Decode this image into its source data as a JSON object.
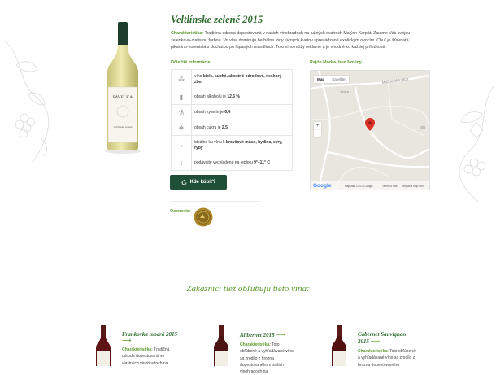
{
  "product": {
    "title": "Veltlínske zelené 2015",
    "desc_label": "Charakteristika:",
    "desc_text": "Tradičná odroda dopestovaná v našich vinohradoch na južných svahoch Malých Karpát. Zaujme Vás svojou zelenkavo-zlatistou farbou. Vo víne dominujú herbálne tóny lúčnych kvetov sprevádzané exotickým ovocím. Chuť je šťavnatá, pikantno-korenistá s dochutou po lúpaných mandliach. Toto víno môžy reklame a je vhodné ku každej príležitosti.",
    "bottle_brand": "PAVELKA",
    "bottle_name": "Veltlínske zelené"
  },
  "details": {
    "label": "Dôležité informácie:",
    "rows": [
      {
        "icon": "grape-icon",
        "pre": "víno ",
        "bold": "biele, suché, akostné odrodové, neskorý zber",
        "post": ""
      },
      {
        "icon": "bottle-icon",
        "pre": "obsah alkoholu je ",
        "bold": "12,6 %",
        "post": ""
      },
      {
        "icon": "flask-icon",
        "pre": "obsah kyselín je ",
        "bold": "6,4",
        "post": ""
      },
      {
        "icon": "sugar-icon",
        "pre": "obsah cukru je ",
        "bold": "2,5",
        "post": ""
      },
      {
        "icon": "food-icon",
        "pre": "ideálne ku vínu k ",
        "bold": "bravčové mäso, hydina, syry, ryby",
        "post": ""
      },
      {
        "icon": "thermometer-icon",
        "pre": "podávajte vychladené na teplotu ",
        "bold": "9°–11° C",
        "post": ""
      }
    ]
  },
  "map": {
    "label": "Rajón Modra, hon Noviny",
    "tab_map": "Map",
    "tab_satellite": "Satellite",
    "zoom_in": "+",
    "zoom_out": "−",
    "google_logo": "Google",
    "footer_data": "Map data ©2016 Google",
    "footer_terms": "Terms of Use",
    "footer_report": "Report a map error",
    "road_label_1": "Modranská ulica",
    "road_label_2": "Vinica",
    "edge_label": "MO"
  },
  "buy": {
    "label": "Kde kúpiť?"
  },
  "awards": {
    "label": "Ocenenia:"
  },
  "recommend": {
    "title": "Zákazníci tiež obľubujú tieto vína:",
    "items": [
      {
        "name": "Frankovka modrá 2015",
        "label": "Charakteristika:",
        "text": "Tradičná odroda dopestovaná vo vlastných vinohradoch na"
      },
      {
        "name": "Alibernet 2015",
        "label": "Charakteristika:",
        "text": "Toto obľúbené a vyhľadávané víno sa zrodilo z hrozna dopestovaného v našich vinohradoch na"
      },
      {
        "name": "Cabernet Sauvignon 2015",
        "label": "Charakteristika:",
        "text": "Toto obľúbené a vyhľadávané víno sa zrodilo z hrozna dopestovaného"
      }
    ]
  },
  "colors": {
    "accent_green": "#5c9a2c",
    "title_green": "#2d6b2e",
    "button_dark_green": "#1f4f37",
    "map_pin_red": "#d93025"
  }
}
